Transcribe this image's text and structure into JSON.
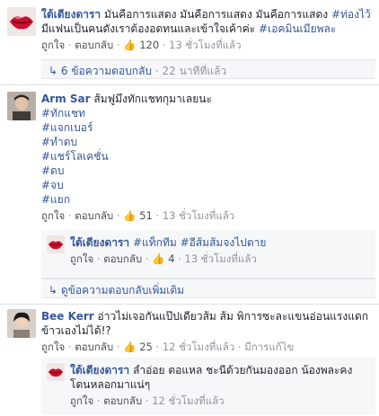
{
  "thread": [
    {
      "author": "ใต้เตียงดารา",
      "text": "มันคือการแสดง มันคือการแสดง มันคือการแสดง",
      "tag1": "#ท่องไว้",
      "line2": "มีแฟนเป็นคนดังเราต้องอดทนและเข้าใจเค้าค่ะ",
      "tag2": "#เอคมินเมียพละ",
      "like_label": "ถูกใจ",
      "reply_label": "ตอบกลับ",
      "likes": "120",
      "time": "13 ชั่วโมงที่แล้ว",
      "replies_summary": "6 ข้อความตอบกลับ",
      "replies_time": "22 นาทีที่แล้ว"
    },
    {
      "author": "Arm Sar",
      "text": "ส้มฟูมึงทักแชทกุมาเลยนะ",
      "tags": [
        "#ทักแชท",
        "#แจกเบอร์",
        "#ทำดบ",
        "#แชร์โลเคชั่น",
        "#ดบ",
        "#จบ",
        "#แยก"
      ],
      "like_label": "ถูกใจ",
      "reply_label": "ตอบกลับ",
      "likes": "51",
      "time": "13 ชั่วโมงที่แล้ว",
      "reply": {
        "author": "ใต้เตียงดารา",
        "tags": "#แท็กทีม #อีส้มส้มจงไปตาย",
        "like_label": "ถูกใจ",
        "reply_label": "ตอบกลับ",
        "likes": "4",
        "time": "13 ชั่วโมงที่แล้ว"
      },
      "more_replies": "ดูข้อความตอบกลับเพิ่มเติม"
    },
    {
      "author": "Bee Kerr",
      "text": "อ่าวไม่เจอกันแป๊ปเดียวส้ม ส้ม พิการซะละแขนอ่อนแรงแดก",
      "line2": "ข้าวเองไม่ได้!?",
      "like_label": "ถูกใจ",
      "reply_label": "ตอบกลับ",
      "likes": "25",
      "time": "12 ชั่วโมงที่แล้ว",
      "edited": "มีการแก้ไข",
      "reply": {
        "author": "ใต้เตียงดารา",
        "text": "ลำอ่อย ตอแหล ชะนีด้วยกันมองออก น้องพละคง",
        "line2": "โดนหลอกมาแน่ๆ",
        "like_label": "ถูกใจ",
        "reply_label": "ตอบกลับ",
        "time": "12 ชั่วโมงที่แล้ว"
      }
    }
  ],
  "colors": {
    "link": "#365899",
    "meta": "#90949c",
    "like": "#4267b2"
  }
}
